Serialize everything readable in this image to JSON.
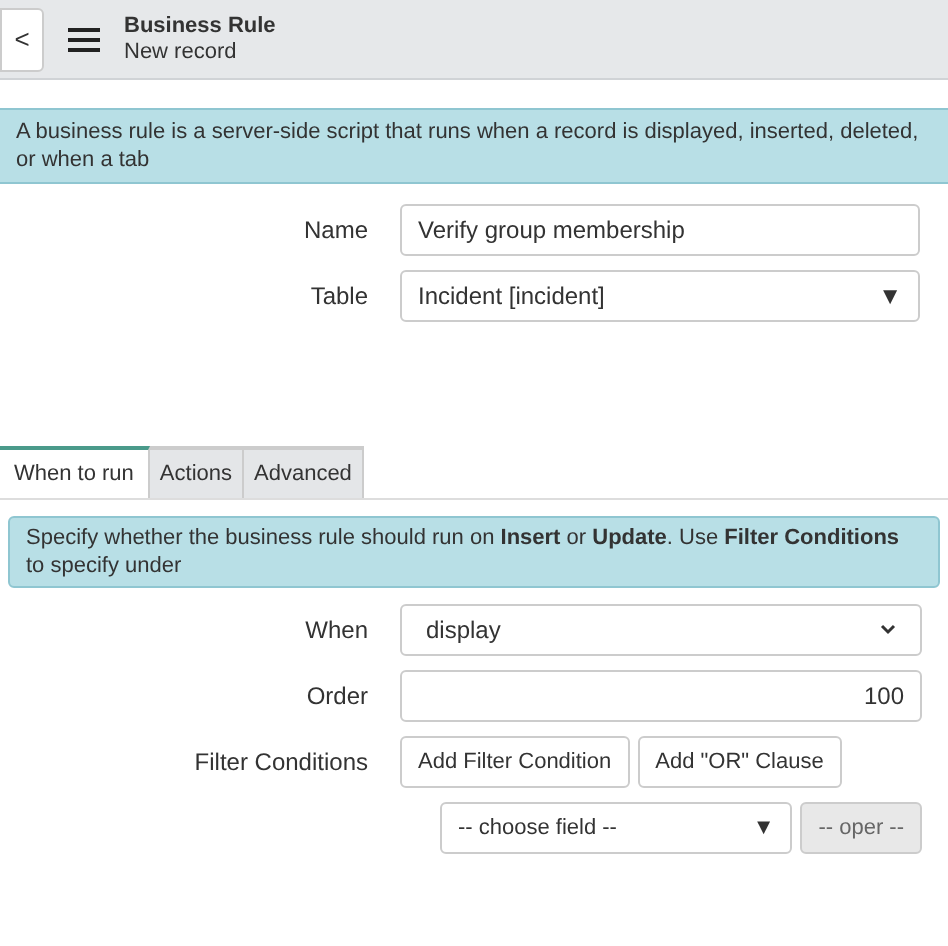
{
  "header": {
    "back_label": "<",
    "title": "Business Rule",
    "subtitle": "New record"
  },
  "info_banner": "A business rule is a server-side script that runs when a record is displayed, inserted, deleted, or when a tab",
  "fields": [
    {
      "kind": "text",
      "label": "Name",
      "value": "Verify group membership"
    },
    {
      "kind": "reference",
      "label": "Table",
      "value": "Incident [incident]",
      "caret": "▼"
    }
  ],
  "tabs": [
    {
      "label": "When to run",
      "selected": true
    },
    {
      "label": "Actions",
      "selected": false
    },
    {
      "label": "Advanced",
      "selected": false
    }
  ],
  "tab_banner": "Specify whether the business rule should run on **Insert** or **Update**. Use **Filter Conditions** to specify under",
  "tab_fields": [
    {
      "kind": "select",
      "label": "When",
      "value": "display"
    },
    {
      "kind": "number",
      "label": "Order",
      "value": "100"
    },
    {
      "kind": "buttons",
      "label": "Filter Conditions",
      "buttons": [
        "Add Filter Condition",
        "Add \"OR\" Clause"
      ]
    }
  ],
  "condition": {
    "field": "-- choose field --",
    "caret": "▼",
    "operator": "-- oper --",
    "operator_disabled": true
  }
}
